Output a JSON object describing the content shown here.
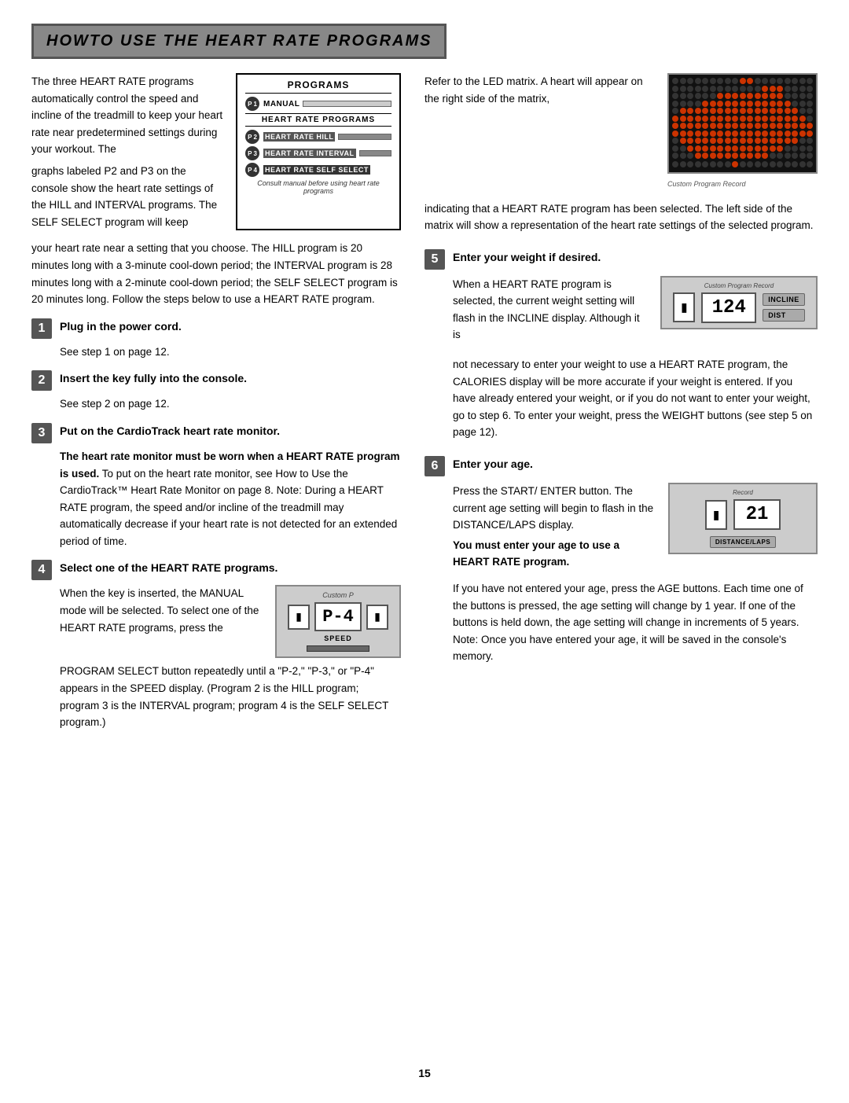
{
  "title": "HowTo USE THE HEART RATE PROGRAMS",
  "intro": {
    "p1": "The three HEART RATE programs automatically control the speed and incline of the treadmill to keep your heart rate near predetermined settings during your workout. The",
    "p2_start": "graphs labeled P2 and P3 on the console show the heart rate settings of the HILL and INTERVAL programs. The SELF SELECT program will keep",
    "p2_end": "your heart rate near a setting that you choose. The HILL program is 20 minutes long with a 3-minute cool-down period; the INTERVAL program is 28 minutes long with a 2-minute cool-down period; the SELF SELECT program is 20 minutes long. Follow the steps below to use a HEART RATE program."
  },
  "programs_box": {
    "title": "PROGRAMS",
    "p1_label": "P 1",
    "p1_sub": "MANUAL",
    "hr_label": "HEART RATE PROGRAMS",
    "p2_label": "P 2",
    "p2_sub": "HEART RATE HILL",
    "p3_label": "P 3",
    "p3_sub": "HEART RATE INTERVAL",
    "p4_label": "P 4",
    "p4_sub": "HEART RATE SELF SELECT",
    "note": "Consult manual before using heart rate programs"
  },
  "steps": {
    "step1": {
      "num": "1",
      "title": "Plug in the power cord.",
      "body": "See step 1 on page 12."
    },
    "step2": {
      "num": "2",
      "title": "Insert the key fully into the console.",
      "body": "See step 2 on page 12."
    },
    "step3": {
      "num": "3",
      "title": "Put on the CardioTrack heart rate monitor.",
      "body1": "The heart rate monitor must be worn when a HEART RATE program is used.",
      "body2": "To put on the heart rate monitor, see How to Use the CardioTrack™ Heart Rate Monitor on page 8. Note: During a HEART RATE program, the speed and/or incline of the treadmill may automatically decrease if your heart rate is not detected for an extended period of time."
    },
    "step4": {
      "num": "4",
      "title": "Select one of the HEART RATE programs.",
      "body1": "When the key is inserted, the MANUAL mode will be selected. To select one of the HEART RATE programs, press the",
      "body2": "PROGRAM SELECT button repeatedly until a \"P-2,\" \"P-3,\" or \"P-4\" appears in the SPEED display. (Program 2 is the HILL program; program 3 is the INTERVAL program; program 4 is the SELF SELECT program.)",
      "display_custom": "Custom P",
      "display_p4": "P-4",
      "display_speed_label": "SPEED"
    },
    "step5": {
      "num": "5",
      "title": "Enter your weight if desired.",
      "body1": "When a HEART RATE program is selected, the current weight setting will flash in the INCLINE display. Although it is",
      "body2": "not necessary to enter your weight to use a HEART RATE program, the CALORIES display will be more accurate if your weight is entered. If you have already entered your weight, or if you do not want to enter your weight, go to step 6. To enter your weight, press the WEIGHT buttons (see step 5 on page 12).",
      "display_val": "124",
      "display_incline_label": "INCLINE",
      "display_dist_label": "DIST",
      "display_custom": "Custom Program Record"
    },
    "step6": {
      "num": "6",
      "title": "Enter your age.",
      "body1": "Press the START/ ENTER button. The current age setting will begin to flash in the DISTANCE/LAPS display.",
      "body2": "You must enter your age to use a HEART RATE program.",
      "body3": "If you have not entered your age, press the AGE buttons. Each time one of the buttons is pressed, the age setting will change by 1 year. If one of the buttons is held down, the age setting will change in increments of 5 years. Note: Once you have entered your age, it will be saved in the console's memory.",
      "display_val": "21",
      "display_dist_laps": "DISTANCE/LAPS",
      "display_custom": "Record"
    }
  },
  "right_intro": {
    "text1": "Refer to the LED matrix. A heart will appear on the right side of the matrix,",
    "text2": "indicating that a HEART RATE program has been selected. The left side of the matrix will show a representation of the heart rate settings of the selected program.",
    "matrix_caption": "Custom Program Record"
  },
  "page_number": "15"
}
